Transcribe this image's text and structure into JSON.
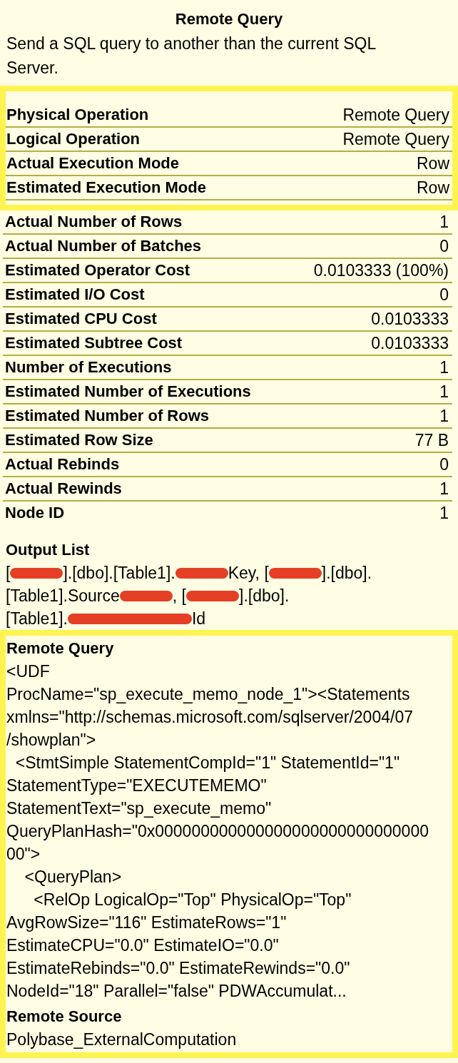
{
  "tooltip": {
    "title": "Remote Query",
    "description": "Send a SQL query to another than the current SQL Server."
  },
  "properties": [
    {
      "label": "Physical Operation",
      "value": "Remote Query",
      "highlighted": true
    },
    {
      "label": "Logical Operation",
      "value": "Remote Query",
      "highlighted": true
    },
    {
      "label": "Actual Execution Mode",
      "value": "Row",
      "highlighted": true
    },
    {
      "label": "Estimated Execution Mode",
      "value": "Row",
      "highlighted": true
    },
    {
      "label": "Actual Number of Rows",
      "value": "1",
      "highlighted": false
    },
    {
      "label": "Actual Number of Batches",
      "value": "0",
      "highlighted": false
    },
    {
      "label": "Estimated Operator Cost",
      "value": "0.0103333 (100%)",
      "highlighted": false
    },
    {
      "label": "Estimated I/O Cost",
      "value": "0",
      "highlighted": false
    },
    {
      "label": "Estimated CPU Cost",
      "value": "0.0103333",
      "highlighted": false
    },
    {
      "label": "Estimated Subtree Cost",
      "value": "0.0103333",
      "highlighted": false
    },
    {
      "label": "Number of Executions",
      "value": "1",
      "highlighted": false
    },
    {
      "label": "Estimated Number of Executions",
      "value": "1",
      "highlighted": false
    },
    {
      "label": "Estimated Number of Rows",
      "value": "1",
      "highlighted": false
    },
    {
      "label": "Estimated Row Size",
      "value": "77 B",
      "highlighted": false
    },
    {
      "label": "Actual Rebinds",
      "value": "0",
      "highlighted": false
    },
    {
      "label": "Actual Rewinds",
      "value": "1",
      "highlighted": false
    },
    {
      "label": "Node ID",
      "value": "1",
      "highlighted": false
    }
  ],
  "sections": [
    {
      "kind": "redacted_lines",
      "heading": "Output List",
      "highlighted": false,
      "lines": [
        {
          "segments": [
            {
              "kind": "text",
              "text": "["
            },
            {
              "kind": "redaction"
            },
            {
              "kind": "text",
              "text": "].[dbo].[Table1]."
            },
            {
              "kind": "redaction"
            },
            {
              "kind": "text",
              "text": "Key, ["
            },
            {
              "kind": "redaction"
            },
            {
              "kind": "text",
              "text": "].[dbo]."
            }
          ]
        },
        {
          "segments": [
            {
              "kind": "text",
              "text": "[Table1].Source"
            },
            {
              "kind": "redaction"
            },
            {
              "kind": "text",
              "text": ", ["
            },
            {
              "kind": "redaction"
            },
            {
              "kind": "text",
              "text": "].[dbo]."
            }
          ]
        },
        {
          "segments": [
            {
              "kind": "text",
              "text": "[Table1]."
            },
            {
              "kind": "wide_redaction"
            },
            {
              "kind": "text",
              "text": "Id"
            }
          ]
        }
      ]
    },
    {
      "kind": "text",
      "heading": "Remote Query",
      "highlighted": true,
      "text": "<UDF\nProcName=\"sp_execute_memo_node_1\"><Statements\nxmlns=\"http://schemas.microsoft.com/sqlserver/2004/07\n/showplan\">\n  <StmtSimple StatementCompId=\"1\" StatementId=\"1\"\nStatementType=\"EXECUTEMEMO\"\nStatementText=\"sp_execute_memo\"\nQueryPlanHash=\"0x000000000000000000000000000000\n00\">\n    <QueryPlan>\n      <RelOp LogicalOp=\"Top\" PhysicalOp=\"Top\"\nAvgRowSize=\"116\" EstimateRows=\"1\"\nEstimateCPU=\"0.0\" EstimateIO=\"0.0\"\nEstimateRebinds=\"0.0\" EstimateRewinds=\"0.0\"\nNodeId=\"18\" Parallel=\"false\" PDWAccumulat..."
    },
    {
      "kind": "text",
      "heading": "Remote Source",
      "highlighted": true,
      "text": "Polybase_ExternalComputation"
    }
  ]
}
